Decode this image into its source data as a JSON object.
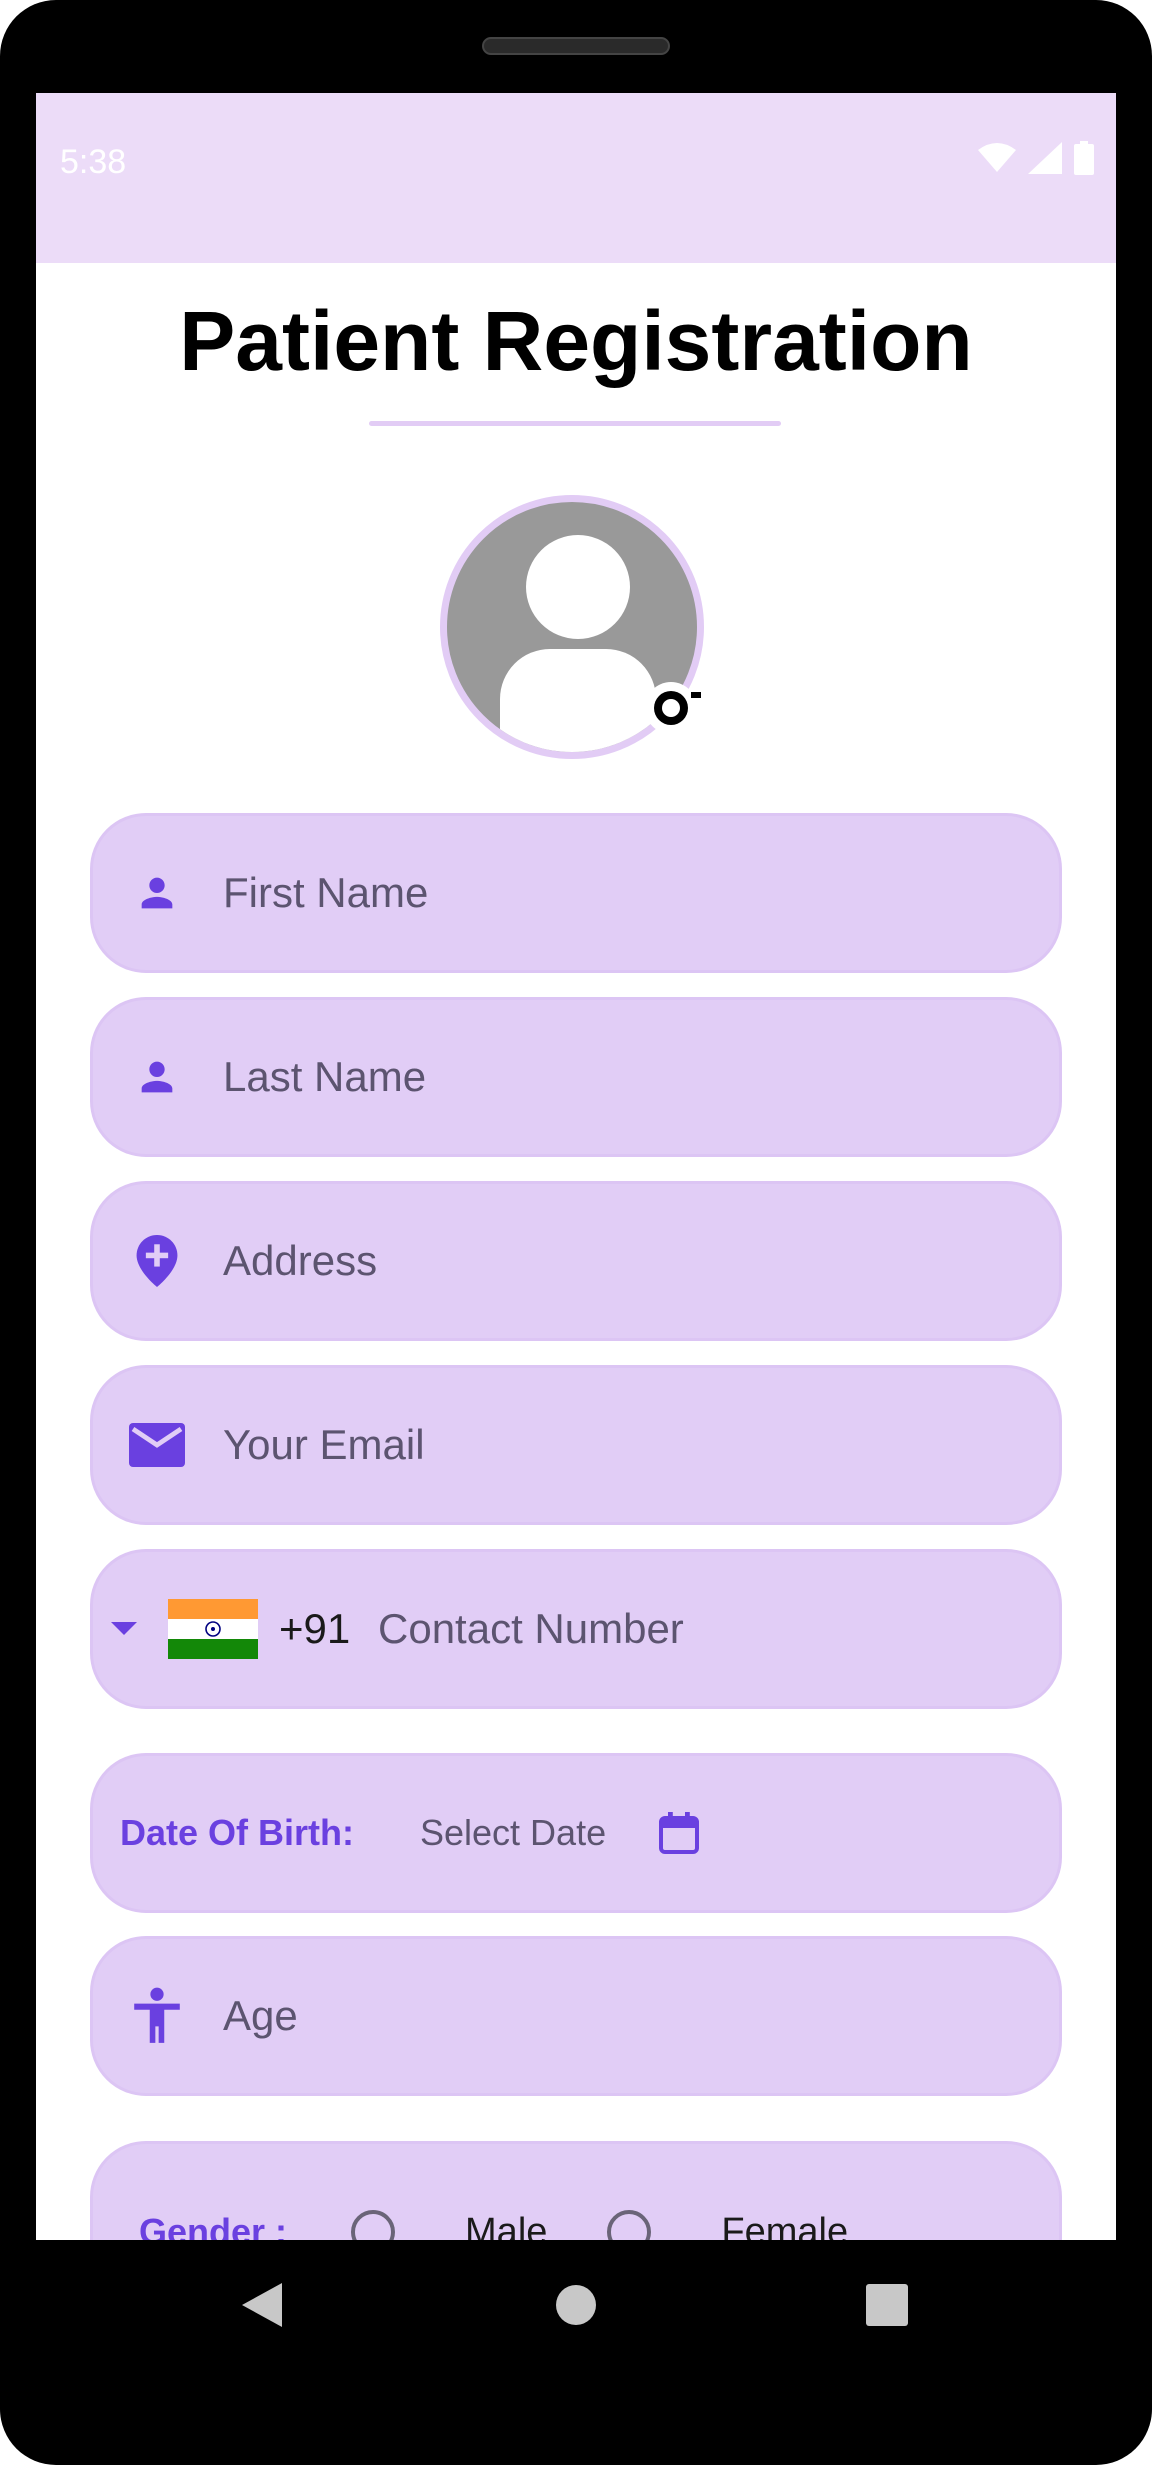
{
  "status_bar": {
    "time": "5:38",
    "icons": [
      "wifi-icon",
      "signal-icon",
      "battery-icon"
    ]
  },
  "page": {
    "title": "Patient Registration"
  },
  "avatar": {
    "icon": "default-user-icon",
    "edit_icon": "camera-icon"
  },
  "form": {
    "first_name": {
      "placeholder": "First Name",
      "icon": "person-icon"
    },
    "last_name": {
      "placeholder": "Last Name",
      "icon": "person-icon"
    },
    "address": {
      "placeholder": "Address",
      "icon": "location-pin-icon"
    },
    "email": {
      "placeholder": "Your Email",
      "icon": "mail-icon"
    },
    "contact": {
      "country_flag": "india-flag-icon",
      "dial_code": "+91",
      "placeholder": "Contact Number"
    },
    "dob": {
      "label": "Date Of Birth:",
      "value": "Select Date",
      "icon": "calendar-icon"
    },
    "age": {
      "placeholder": "Age",
      "icon": "accessibility-icon"
    },
    "gender": {
      "label": "Gender :",
      "options": [
        "Male",
        "Female"
      ]
    }
  },
  "colors": {
    "accent": "#6a40e0",
    "field_bg": "#e1cdf6",
    "status_bar": "#ecdcf8"
  },
  "nav": {
    "icons": [
      "back-icon",
      "home-icon",
      "recents-icon"
    ]
  }
}
